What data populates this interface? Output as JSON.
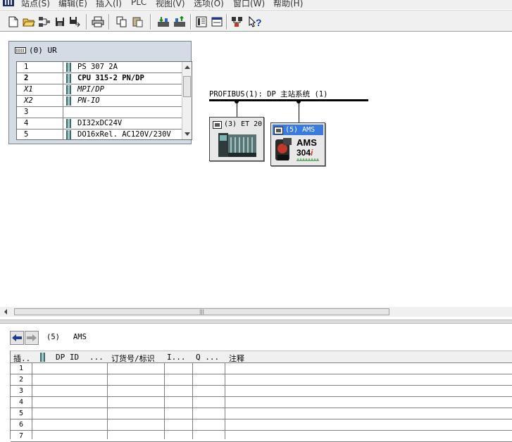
{
  "menu": {
    "items": [
      "站点(S)",
      "编辑(E)",
      "插入(I)",
      "PLC",
      "视图(V)",
      "选项(O)",
      "窗口(W)",
      "帮助(H)"
    ]
  },
  "toolbar": {
    "buttons": [
      "new-icon",
      "open-icon",
      "network-icon",
      "save-icon",
      "save-compile-icon",
      "print-icon",
      "copy-icon",
      "paste-icon",
      "download-icon",
      "upload-icon",
      "catalog-icon",
      "overview-icon",
      "netpro-icon",
      "help-icon"
    ]
  },
  "rack": {
    "title": "(0) UR",
    "rows": [
      {
        "slot": "1",
        "desc": "PS 307 2A",
        "style": "normal",
        "has_icon": true
      },
      {
        "slot": "2",
        "desc": "CPU 315-2 PN/DP",
        "style": "bold",
        "has_icon": true
      },
      {
        "slot": "X1",
        "desc": "MPI/DP",
        "style": "italic",
        "has_icon": true
      },
      {
        "slot": "X2",
        "desc": "PN-IO",
        "style": "italic",
        "has_icon": true
      },
      {
        "slot": "3",
        "desc": "",
        "style": "normal",
        "has_icon": false
      },
      {
        "slot": "4",
        "desc": "DI32xDC24V",
        "style": "normal",
        "has_icon": true
      },
      {
        "slot": "5",
        "desc": "DO16xRel. AC120V/230V",
        "style": "normal",
        "has_icon": true
      }
    ]
  },
  "profibus": {
    "label": "PROFIBUS(1): DP 主站系统 (1)"
  },
  "slaves": {
    "et200": {
      "label": "(3) ET 20"
    },
    "ams": {
      "label": "(5) AMS",
      "product": "AMS",
      "model_num": "304",
      "model_suffix": "i"
    }
  },
  "detail": {
    "title": "(5)   AMS",
    "columns": [
      "插..",
      "DP ID",
      "...",
      "订货号/标识",
      "I...",
      "Q ...",
      "注释"
    ],
    "rows": [
      "1",
      "2",
      "3",
      "4",
      "5",
      "6",
      "7"
    ]
  },
  "colors": {
    "selection": "#3a7be0",
    "rack_bg": "#d4dbe4",
    "nav_arrow_left": "#1f3b8f",
    "nav_arrow_right": "#9a9a9a"
  }
}
